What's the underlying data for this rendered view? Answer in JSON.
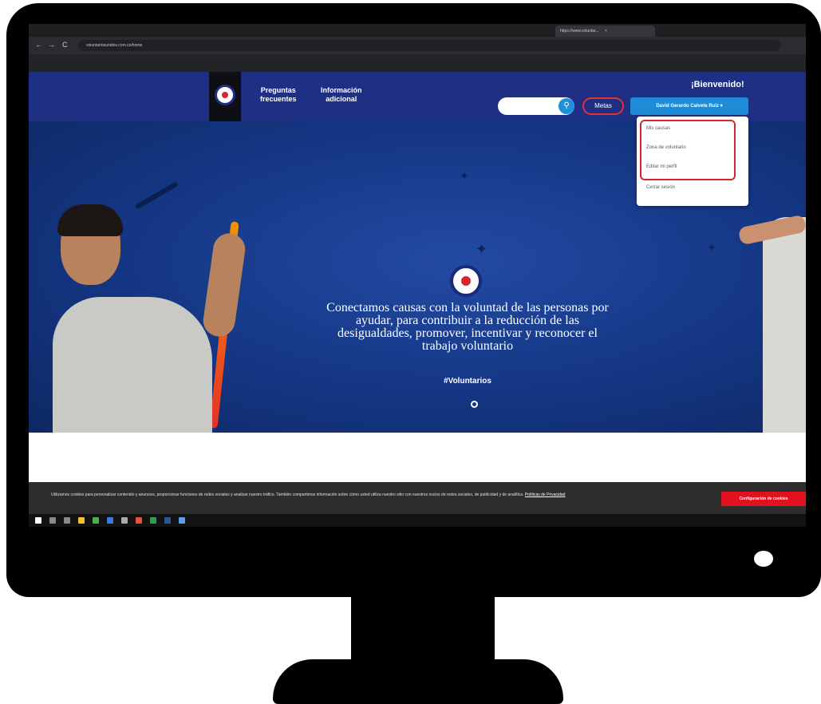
{
  "browser": {
    "tab_title": "https://www.voluntar...",
    "tab_close": "×",
    "url": "voluntariosunidos.com.co/home",
    "nav": {
      "back": "←",
      "forward": "→",
      "reload": "C"
    }
  },
  "header": {
    "nav_links": [
      {
        "line1": "Preguntas",
        "line2": "frecuentes"
      },
      {
        "line1": "Información",
        "line2": "adicional"
      }
    ],
    "welcome": "¡Bienvenido!",
    "search_icon": "search-icon",
    "search_glyph": "⚲",
    "metas_label": "Metas",
    "user_button": "David Gerardo Calvete Ruiz ▾"
  },
  "dropdown": {
    "items": [
      "Mis causas",
      "Zona de voluntario",
      "Editar mi perfil",
      "Cerrar sesión"
    ]
  },
  "hero": {
    "headline": [
      "Conectamos causas con la voluntad de las personas por",
      "ayudar, para contribuir a la reducción de las",
      "desigualdades, promover, incentivar y reconocer el",
      "trabajo voluntario"
    ],
    "hashtag": "#Voluntarios"
  },
  "cookies": {
    "text": "Utilizamos cookies para personalizar contenido y anuncios, proporcionar funciones de redes sociales y analizar nuestro tráfico. También compartimos información sobre cómo usted utiliza nuestro sitio con nuestros socios de redes sociales, de publicidad y de analítica.",
    "link": "Políticas de Privacidad",
    "button": "Configuración de cookies"
  },
  "colors": {
    "header_blue": "#1f2f84",
    "accent_red": "#d7262b",
    "button_blue": "#1e8bd6",
    "hero_orange": "#f39200"
  }
}
